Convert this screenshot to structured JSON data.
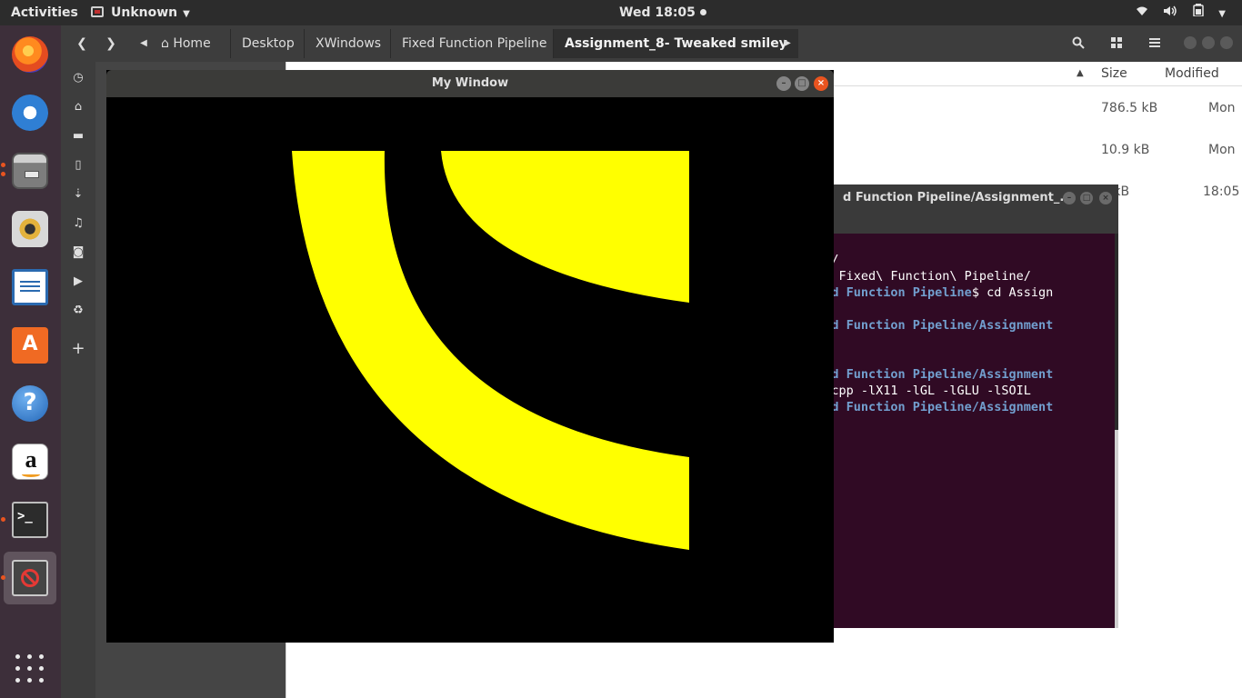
{
  "topbar": {
    "activities": "Activities",
    "app_name": "Unknown",
    "clock": "Wed 18:05"
  },
  "nautilus": {
    "breadcrumbs": [
      "Home",
      "Desktop",
      "XWindows",
      "Fixed Function Pipeline",
      "Assignment_8- Tweaked smiley"
    ],
    "columns": {
      "size": "Size",
      "modified": "Modified"
    },
    "files": [
      {
        "size": "786.5 kB",
        "modified": "Mon"
      },
      {
        "size": "10.9 kB",
        "modified": "Mon"
      },
      {
        "size": "0 kB",
        "modified": "18:05"
      }
    ]
  },
  "terminal": {
    "title": "d Function Pipeline/Assignment_...",
    "lines": [
      {
        "prompt": "",
        "text": "ows/"
      },
      {
        "prompt": "",
        "text": " cd Fixed\\ Function\\ Pipeline/"
      },
      {
        "prompt": "ixed Function Pipeline",
        "text": "$ cd Assign"
      },
      {
        "prompt": "",
        "text": ""
      },
      {
        "prompt": "ixed Function Pipeline/Assignment",
        "text": ""
      },
      {
        "prompt": "",
        "text": ""
      },
      {
        "prompt": "",
        "text": ""
      },
      {
        "prompt": "ixed Function Pipeline/Assignment",
        "text": ""
      },
      {
        "prompt": "",
        "text": "ey.cpp -lX11 -lGL -lGLU -lSOIL"
      },
      {
        "prompt": "ixed Function Pipeline/Assignment",
        "text": ""
      }
    ]
  },
  "glwindow": {
    "title": "My Window",
    "fill_color": "#ffff00",
    "background_color": "#000000"
  },
  "colors": {
    "accent": "#e95420",
    "terminal_bg": "#300a24",
    "prompt": "#729fcf"
  }
}
